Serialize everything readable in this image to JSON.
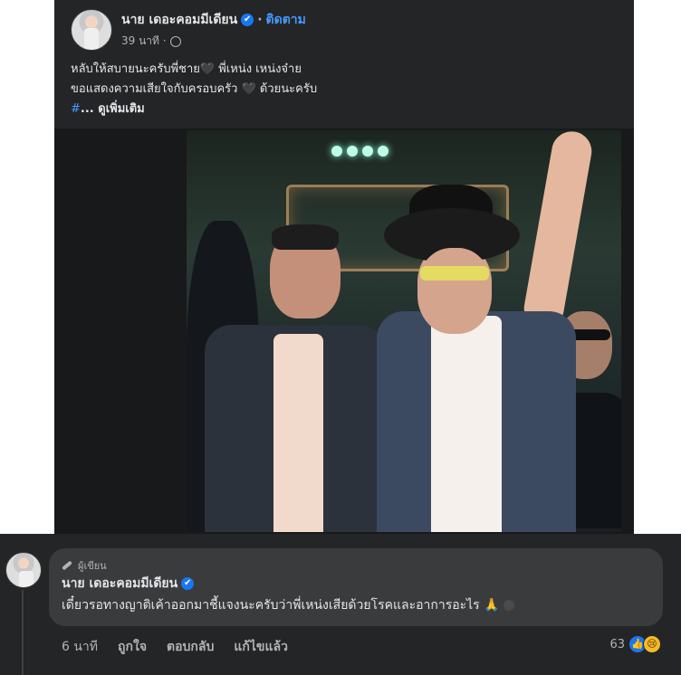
{
  "post": {
    "author": "นาย เดอะคอมมีเดียน",
    "verified_glyph": "✔",
    "dot": "·",
    "follow": "ติดตาม",
    "time": "39 นาที ·",
    "body_line1": "หลับให้สบายนะครับพี่ชาย🖤 พี่เหน่ง เหน่งจ๋าย",
    "body_line2": "ขอแสดงความเสียใจกับครอบครัว 🖤 ด้วยนะครับ",
    "hashtag": "#",
    "see_more": "... ดูเพิ่มเติม"
  },
  "comment": {
    "badge": "ผู้เขียน",
    "author": "นาย เดอะคอมมีเดียน",
    "text": "เดี๋ยวรอทางญาติเค้าออกมาชี้แจงนะครับว่าพี่เหน่งเสียด้วยโรคและอาการอะไร",
    "pray_emoji": "🙏",
    "time": "6 นาที",
    "like": "ถูกใจ",
    "reply": "ตอบกลับ",
    "edited": "แก้ไขแล้ว",
    "reaction_count": "63",
    "like_glyph": "👍",
    "sad_glyph": "😢"
  },
  "colors": {
    "card_bg": "#242526",
    "bubble_bg": "#3a3b3c",
    "link": "#4599ff",
    "verified": "#1877f2"
  }
}
